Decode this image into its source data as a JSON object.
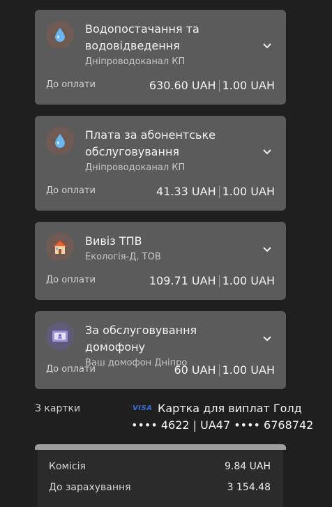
{
  "payments": [
    {
      "icon": "water-drop-icon",
      "title": "Водопостачання та водовідведення",
      "provider": "Дніпроводоканал КП",
      "due_label": "До оплати",
      "amount": "630.60 UAH",
      "fee": "1.00 UAH"
    },
    {
      "icon": "water-drop-icon",
      "title": "Плата за абонентське обслуговування",
      "provider": "Дніпроводоканал КП",
      "due_label": "До оплати",
      "amount": "41.33 UAH",
      "fee": "1.00 UAH"
    },
    {
      "icon": "house-icon",
      "title": "Вивіз ТПВ",
      "provider": "Екологія-Д, ТОВ",
      "due_label": "До оплати",
      "amount": "109.71 UAH",
      "fee": "1.00 UAH"
    },
    {
      "icon": "intercom-icon",
      "title": "За обслуговування домофону",
      "provider": "Ваш домофон Дніпро",
      "due_label": "До оплати",
      "amount": "60 UAH",
      "fee": "1.00 UAH"
    }
  ],
  "payment_source": {
    "label": "З картки",
    "card_brand": "VISA",
    "card_name": "Картка для виплат Голд",
    "card_number": "•••• 4622 | UA47 •••• 6768742"
  },
  "summary": {
    "commission_label": "Комісія",
    "commission_value": "9.84 UAH",
    "credit_label": "До зарахування",
    "credit_value": "3 154.48"
  },
  "colors": {
    "card_bg": "#5b5b5b",
    "page_bg": "#1f1f1f",
    "visa_blue": "#3a6fd8"
  }
}
